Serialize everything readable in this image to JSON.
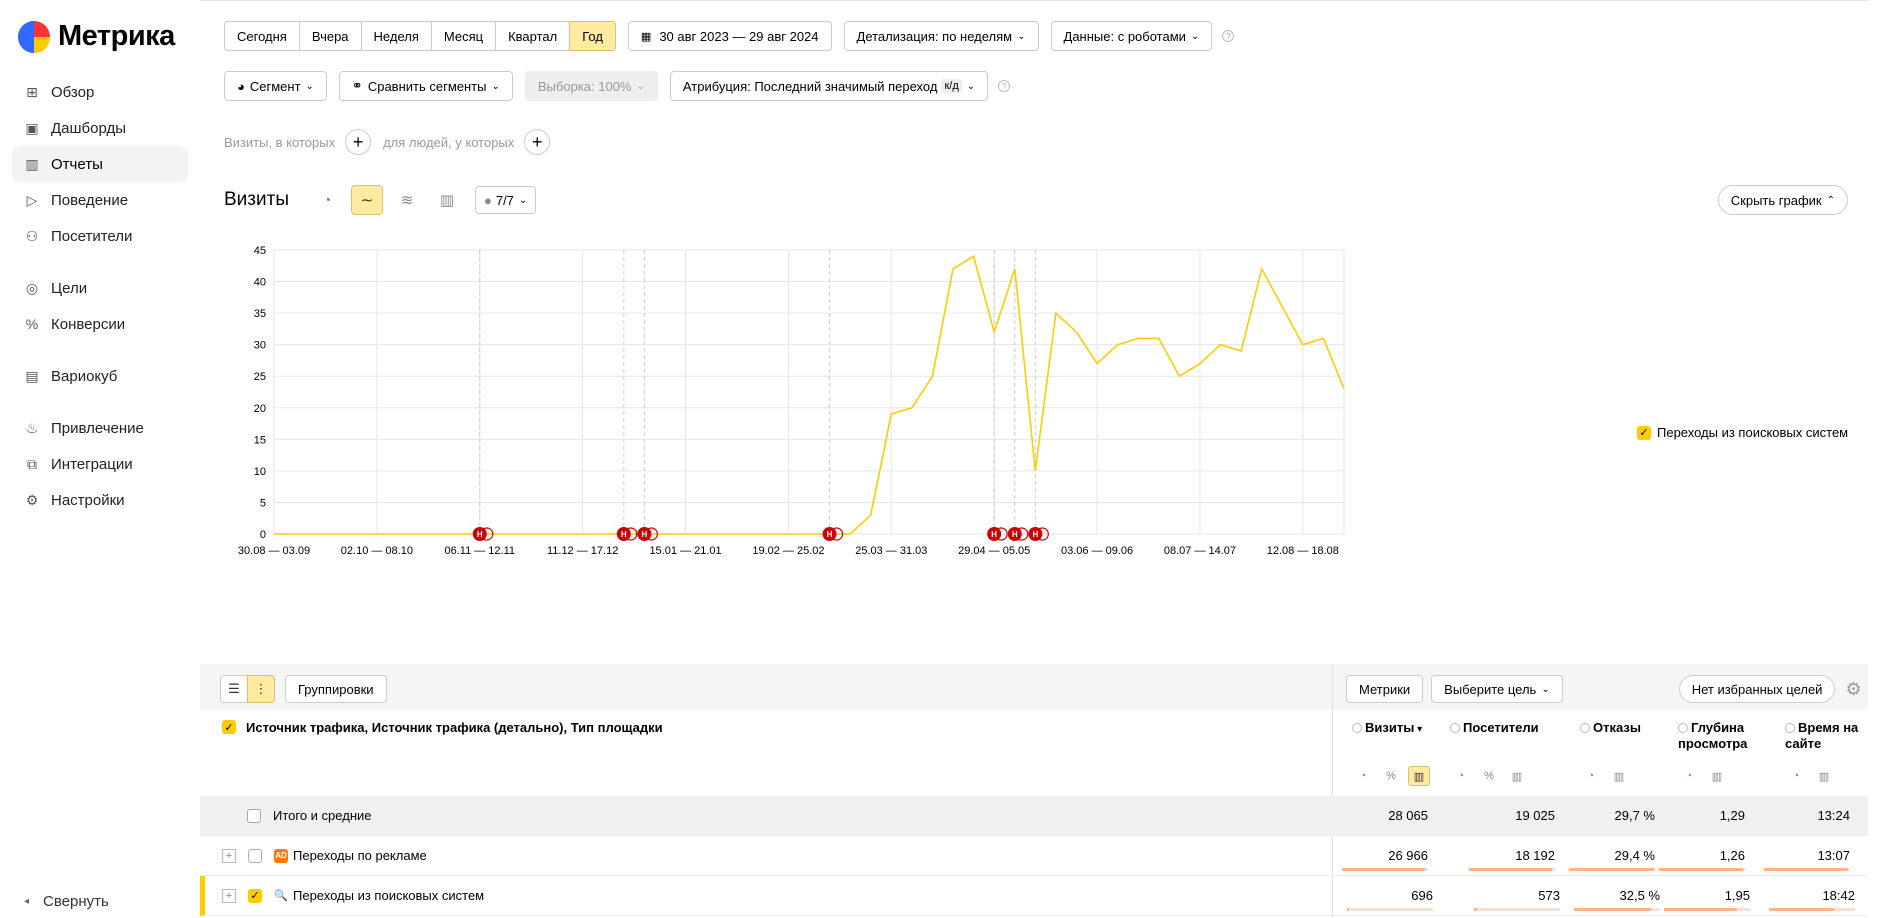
{
  "app": {
    "logo_text": "Метрика"
  },
  "sidebar": {
    "items": [
      {
        "label": "Обзор",
        "icon": "grid-icon"
      },
      {
        "label": "Дашборды",
        "icon": "dashboard-icon"
      },
      {
        "label": "Отчеты",
        "icon": "bar-chart-icon",
        "active": true
      },
      {
        "label": "Поведение",
        "icon": "play-icon"
      },
      {
        "label": "Посетители",
        "icon": "user-icon"
      },
      {
        "label": "Цели",
        "icon": "target-icon"
      },
      {
        "label": "Конверсии",
        "icon": "percent-icon"
      },
      {
        "label": "Вариокуб",
        "icon": "cube-icon"
      },
      {
        "label": "Привлечение",
        "icon": "flame-icon"
      },
      {
        "label": "Интеграции",
        "icon": "plug-icon"
      },
      {
        "label": "Настройки",
        "icon": "gear-icon"
      }
    ],
    "collapse_label": "Свернуть"
  },
  "toolbar": {
    "periods": [
      "Сегодня",
      "Вчера",
      "Неделя",
      "Месяц",
      "Квартал",
      "Год"
    ],
    "selected_period": "Год",
    "date_range": "30 авг 2023 — 29 авг 2024",
    "detail": "Детализация: по неделям",
    "data": "Данные: с роботами",
    "segment": "Сегмент",
    "compare": "Сравнить сегменты",
    "sample": "Выборка: 100%",
    "attribution": "Атрибуция: Последний значимый переход",
    "attribution_badge": "к/д"
  },
  "filters": {
    "visits_label": "Визиты, в которых",
    "people_label": "для людей, у которых"
  },
  "chart_header": {
    "title": "Визиты",
    "series_count": "7/7",
    "hide_button": "Скрыть график"
  },
  "chart_data": {
    "type": "line",
    "title": "",
    "ylim": [
      0,
      45
    ],
    "yticks": [
      0,
      5,
      10,
      15,
      20,
      25,
      30,
      35,
      40,
      45
    ],
    "xtick_labels": [
      "30.08 — 03.09",
      "02.10 — 08.10",
      "06.11 — 12.11",
      "11.12 — 17.12",
      "15.01 — 21.01",
      "19.02 — 25.02",
      "25.03 — 31.03",
      "29.04 — 05.05",
      "03.06 — 09.06",
      "08.07 — 14.07",
      "12.08 — 18.08"
    ],
    "xtick_index": [
      0,
      5,
      10,
      15,
      20,
      25,
      30,
      35,
      40,
      45,
      50
    ],
    "grid": true,
    "legend_position": "right",
    "series": [
      {
        "name": "Переходы из поисковых систем",
        "color": "#ffcc00",
        "values": [
          0,
          0,
          0,
          0,
          0,
          0,
          0,
          0,
          0,
          0,
          0,
          0,
          0,
          0,
          0,
          0,
          0,
          0,
          0,
          0,
          0,
          0,
          0,
          0,
          0,
          0,
          0,
          0,
          0,
          3,
          19,
          20,
          25,
          42,
          44,
          32,
          42,
          10,
          35,
          32,
          27,
          30,
          31,
          31,
          25,
          27,
          30,
          29,
          42,
          36,
          30,
          31,
          23
        ]
      }
    ],
    "event_markers": {
      "label": "Н",
      "color": "#cc0000",
      "x_index": [
        10,
        17,
        18,
        27,
        35,
        36,
        37
      ]
    }
  },
  "table_toolbar": {
    "groupings": "Группировки",
    "metrics": "Метрики",
    "choose_goal": "Выберите цель",
    "no_favorites": "Нет избранных целей"
  },
  "table": {
    "dimension_header": "Источник трафика, Источник трафика (детально), Тип площадки",
    "columns": [
      "Визиты",
      "Посетители",
      "Отказы",
      "Глубина просмотра",
      "Время на сайте"
    ],
    "sort_column": "Визиты",
    "total_label": "Итого и средние",
    "total": [
      "28 065",
      "19 025",
      "29,7 %",
      "1,29",
      "13:24"
    ],
    "rows": [
      {
        "label": "Переходы по рекламе",
        "icon": "ad-icon",
        "icon_text": "AD",
        "icon_color": "#ff7a00",
        "checked": false,
        "values": [
          "26 966",
          "18 192",
          "29,4 %",
          "1,26",
          "13:07"
        ],
        "bars": [
          0.96,
          0.96,
          0.99,
          0.98,
          0.98
        ]
      },
      {
        "label": "Переходы из поисковых систем",
        "icon": "search-icon",
        "icon_text": "",
        "icon_color": "#e5332a",
        "checked": true,
        "values": [
          "696",
          "573",
          "32,5 %",
          "1,95",
          "18:42"
        ],
        "bars": [
          0.02,
          0.03,
          0.9,
          0.85,
          0.75
        ]
      }
    ]
  }
}
